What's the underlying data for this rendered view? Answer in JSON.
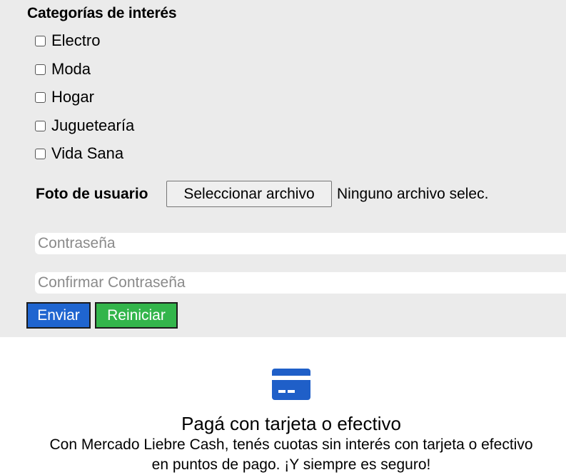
{
  "form": {
    "categories_title": "Categorías de interés",
    "categories": [
      {
        "label": "Electro",
        "checked": false
      },
      {
        "label": "Moda",
        "checked": false
      },
      {
        "label": "Hogar",
        "checked": false
      },
      {
        "label": "Juguetearía",
        "checked": false
      },
      {
        "label": "Vida Sana",
        "checked": false
      }
    ],
    "photo_label": "Foto de usuario",
    "file_button_label": "Seleccionar archivo",
    "file_status": "Ninguno archivo selec.",
    "password_placeholder": "Contraseña",
    "confirm_password_placeholder": "Confirmar Contraseña",
    "submit_label": "Enviar",
    "reset_label": "Reiniciar"
  },
  "promo": {
    "icon": "credit-card-icon",
    "title": "Pagá con tarjeta o efectivo",
    "text_line1": "Con Mercado Liebre Cash, tenés cuotas sin interés con tarjeta o efectivo",
    "text_line2": "en puntos de pago. ¡Y siempre es seguro!"
  },
  "colors": {
    "panel_bg": "#ebebeb",
    "submit_bg": "#1f65d0",
    "reset_bg": "#33b54b",
    "icon_blue": "#1f5fc8"
  }
}
